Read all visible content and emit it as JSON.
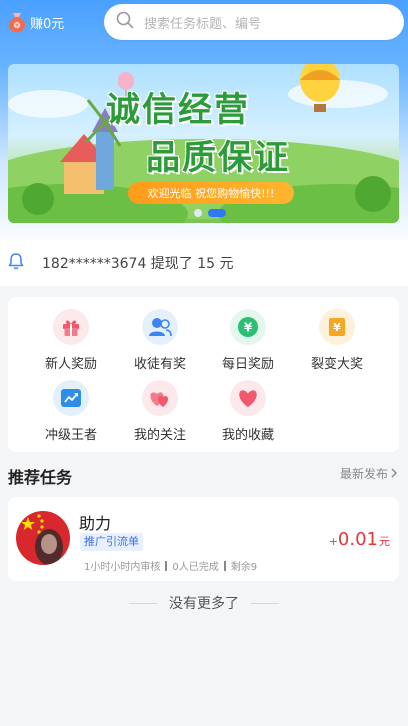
{
  "header": {
    "earn_label": "赚0元",
    "search_placeholder": "搜索任务标题、编号"
  },
  "banner": {
    "title_line1": "诚信经营",
    "title_line2": "品质保证",
    "ribbon": "欢迎光临 祝您购物愉快!!!",
    "active_slide": 2,
    "slide_count": 2
  },
  "notice": {
    "icon": "bell-icon",
    "text": "182******3674 提现了 15 元"
  },
  "menu": [
    {
      "label": "新人奖励",
      "icon": "gift-icon",
      "color": "#f2576b",
      "bg": "#fde9ec"
    },
    {
      "label": "收徒有奖",
      "icon": "users-icon",
      "color": "#3b86f0",
      "bg": "#e6f0fd"
    },
    {
      "label": "每日奖励",
      "icon": "yuan-coin-icon",
      "color": "#2bbf73",
      "bg": "#e3f7ec"
    },
    {
      "label": "裂变大奖",
      "icon": "yuan-ticket-icon",
      "color": "#f5a623",
      "bg": "#fdf1dc"
    },
    {
      "label": "冲级王者",
      "icon": "trend-up-icon",
      "color": "#2e8de6",
      "bg": "#e3f0fc"
    },
    {
      "label": "我的关注",
      "icon": "hearts-icon",
      "color": "#f2576b",
      "bg": "#fde9ec"
    },
    {
      "label": "我的收藏",
      "icon": "heart-icon",
      "color": "#f2576b",
      "bg": "#fde9ec"
    }
  ],
  "section": {
    "title": "推荐任务",
    "more": "最新发布"
  },
  "task": {
    "title": "助力",
    "tag": "推广引流单",
    "review": "1小时小时内审核",
    "completed": "0人已完成",
    "remaining": "剩余9",
    "price_plus": "+",
    "price": "0.01",
    "price_unit": "元"
  },
  "footer": {
    "no_more": "没有更多了"
  }
}
